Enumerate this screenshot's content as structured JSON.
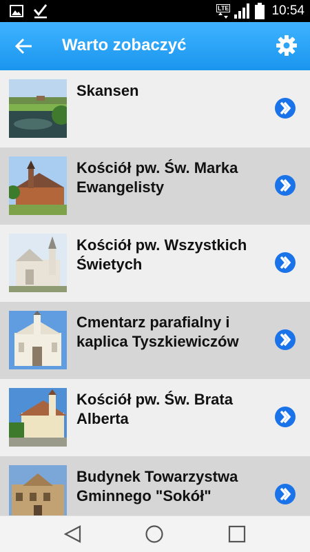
{
  "status_bar": {
    "time": "10:54",
    "network_label": "LTE",
    "icons": [
      "image-notification-icon",
      "check-notification-icon",
      "lte-icon",
      "signal-icon",
      "battery-icon"
    ]
  },
  "app_bar": {
    "title": "Warto zobaczyć",
    "back_icon": "arrow-left-icon",
    "settings_icon": "gear-icon",
    "color": "#2ea4f6"
  },
  "places": [
    {
      "name": "Skansen",
      "thumb": "pond-landscape"
    },
    {
      "name": "Kościół pw. Św. Marka Ewangelisty",
      "thumb": "wooden-church"
    },
    {
      "name": "Kościół pw. Wszystkich Świetych",
      "thumb": "white-church"
    },
    {
      "name": "Cmentarz parafialny i kaplica Tyszkiewiczów",
      "thumb": "chapel-front"
    },
    {
      "name": "Kościół pw. Św. Brata Alberta",
      "thumb": "modern-church"
    },
    {
      "name": "Budynek Towarzystwa Gminnego \"Sokół\"",
      "thumb": "brick-building"
    }
  ],
  "row_colors": {
    "odd": "#efefef",
    "even": "#d6d6d6"
  },
  "chevron_color": "#1a73e8",
  "nav_bar": {
    "icons": [
      "back-triangle-icon",
      "home-circle-icon",
      "recents-square-icon"
    ]
  }
}
